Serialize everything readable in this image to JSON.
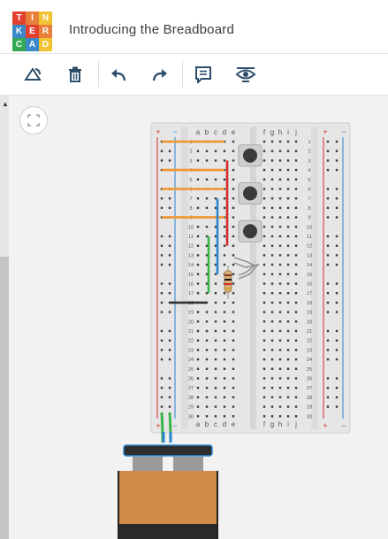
{
  "app": {
    "logo_letters": [
      "T",
      "I",
      "N",
      "K",
      "E",
      "R",
      "C",
      "A",
      "D"
    ],
    "logo_colors": [
      "#e2412f",
      "#e8803a",
      "#f1c232",
      "#3b88c6",
      "#e2412f",
      "#e8803a",
      "#34a853",
      "#3b88c6",
      "#f1c232"
    ],
    "project_title": "Introducing the Breadboard"
  },
  "toolbar": {
    "buttons": [
      {
        "name": "rotate-button",
        "icon": "rotate-icon"
      },
      {
        "name": "delete-button",
        "icon": "trash-icon"
      },
      {
        "name": "undo-button",
        "icon": "undo-icon"
      },
      {
        "name": "redo-button",
        "icon": "redo-icon"
      },
      {
        "name": "notes-button",
        "icon": "notes-icon"
      },
      {
        "name": "visibility-button",
        "icon": "eye-icon"
      }
    ]
  },
  "canvas": {
    "fit_view_icon": "fit-view-icon",
    "breadboard": {
      "column_labels_left": [
        "a",
        "b",
        "c",
        "d",
        "e"
      ],
      "column_labels_right": [
        "f",
        "g",
        "h",
        "i",
        "j"
      ],
      "row_count": 30,
      "rail_plus": "+",
      "rail_minus": "−"
    },
    "wire_colors": {
      "orange": "#f0962c",
      "red": "#d62a2a",
      "blue": "#2a86d0",
      "green": "#3cb44a",
      "black": "#333333"
    },
    "battery_colors": {
      "body": "#d28a4a",
      "bottom": "#2a2a2a",
      "cap": "#2e2e2e",
      "terminal": "#9a9a9a"
    }
  }
}
